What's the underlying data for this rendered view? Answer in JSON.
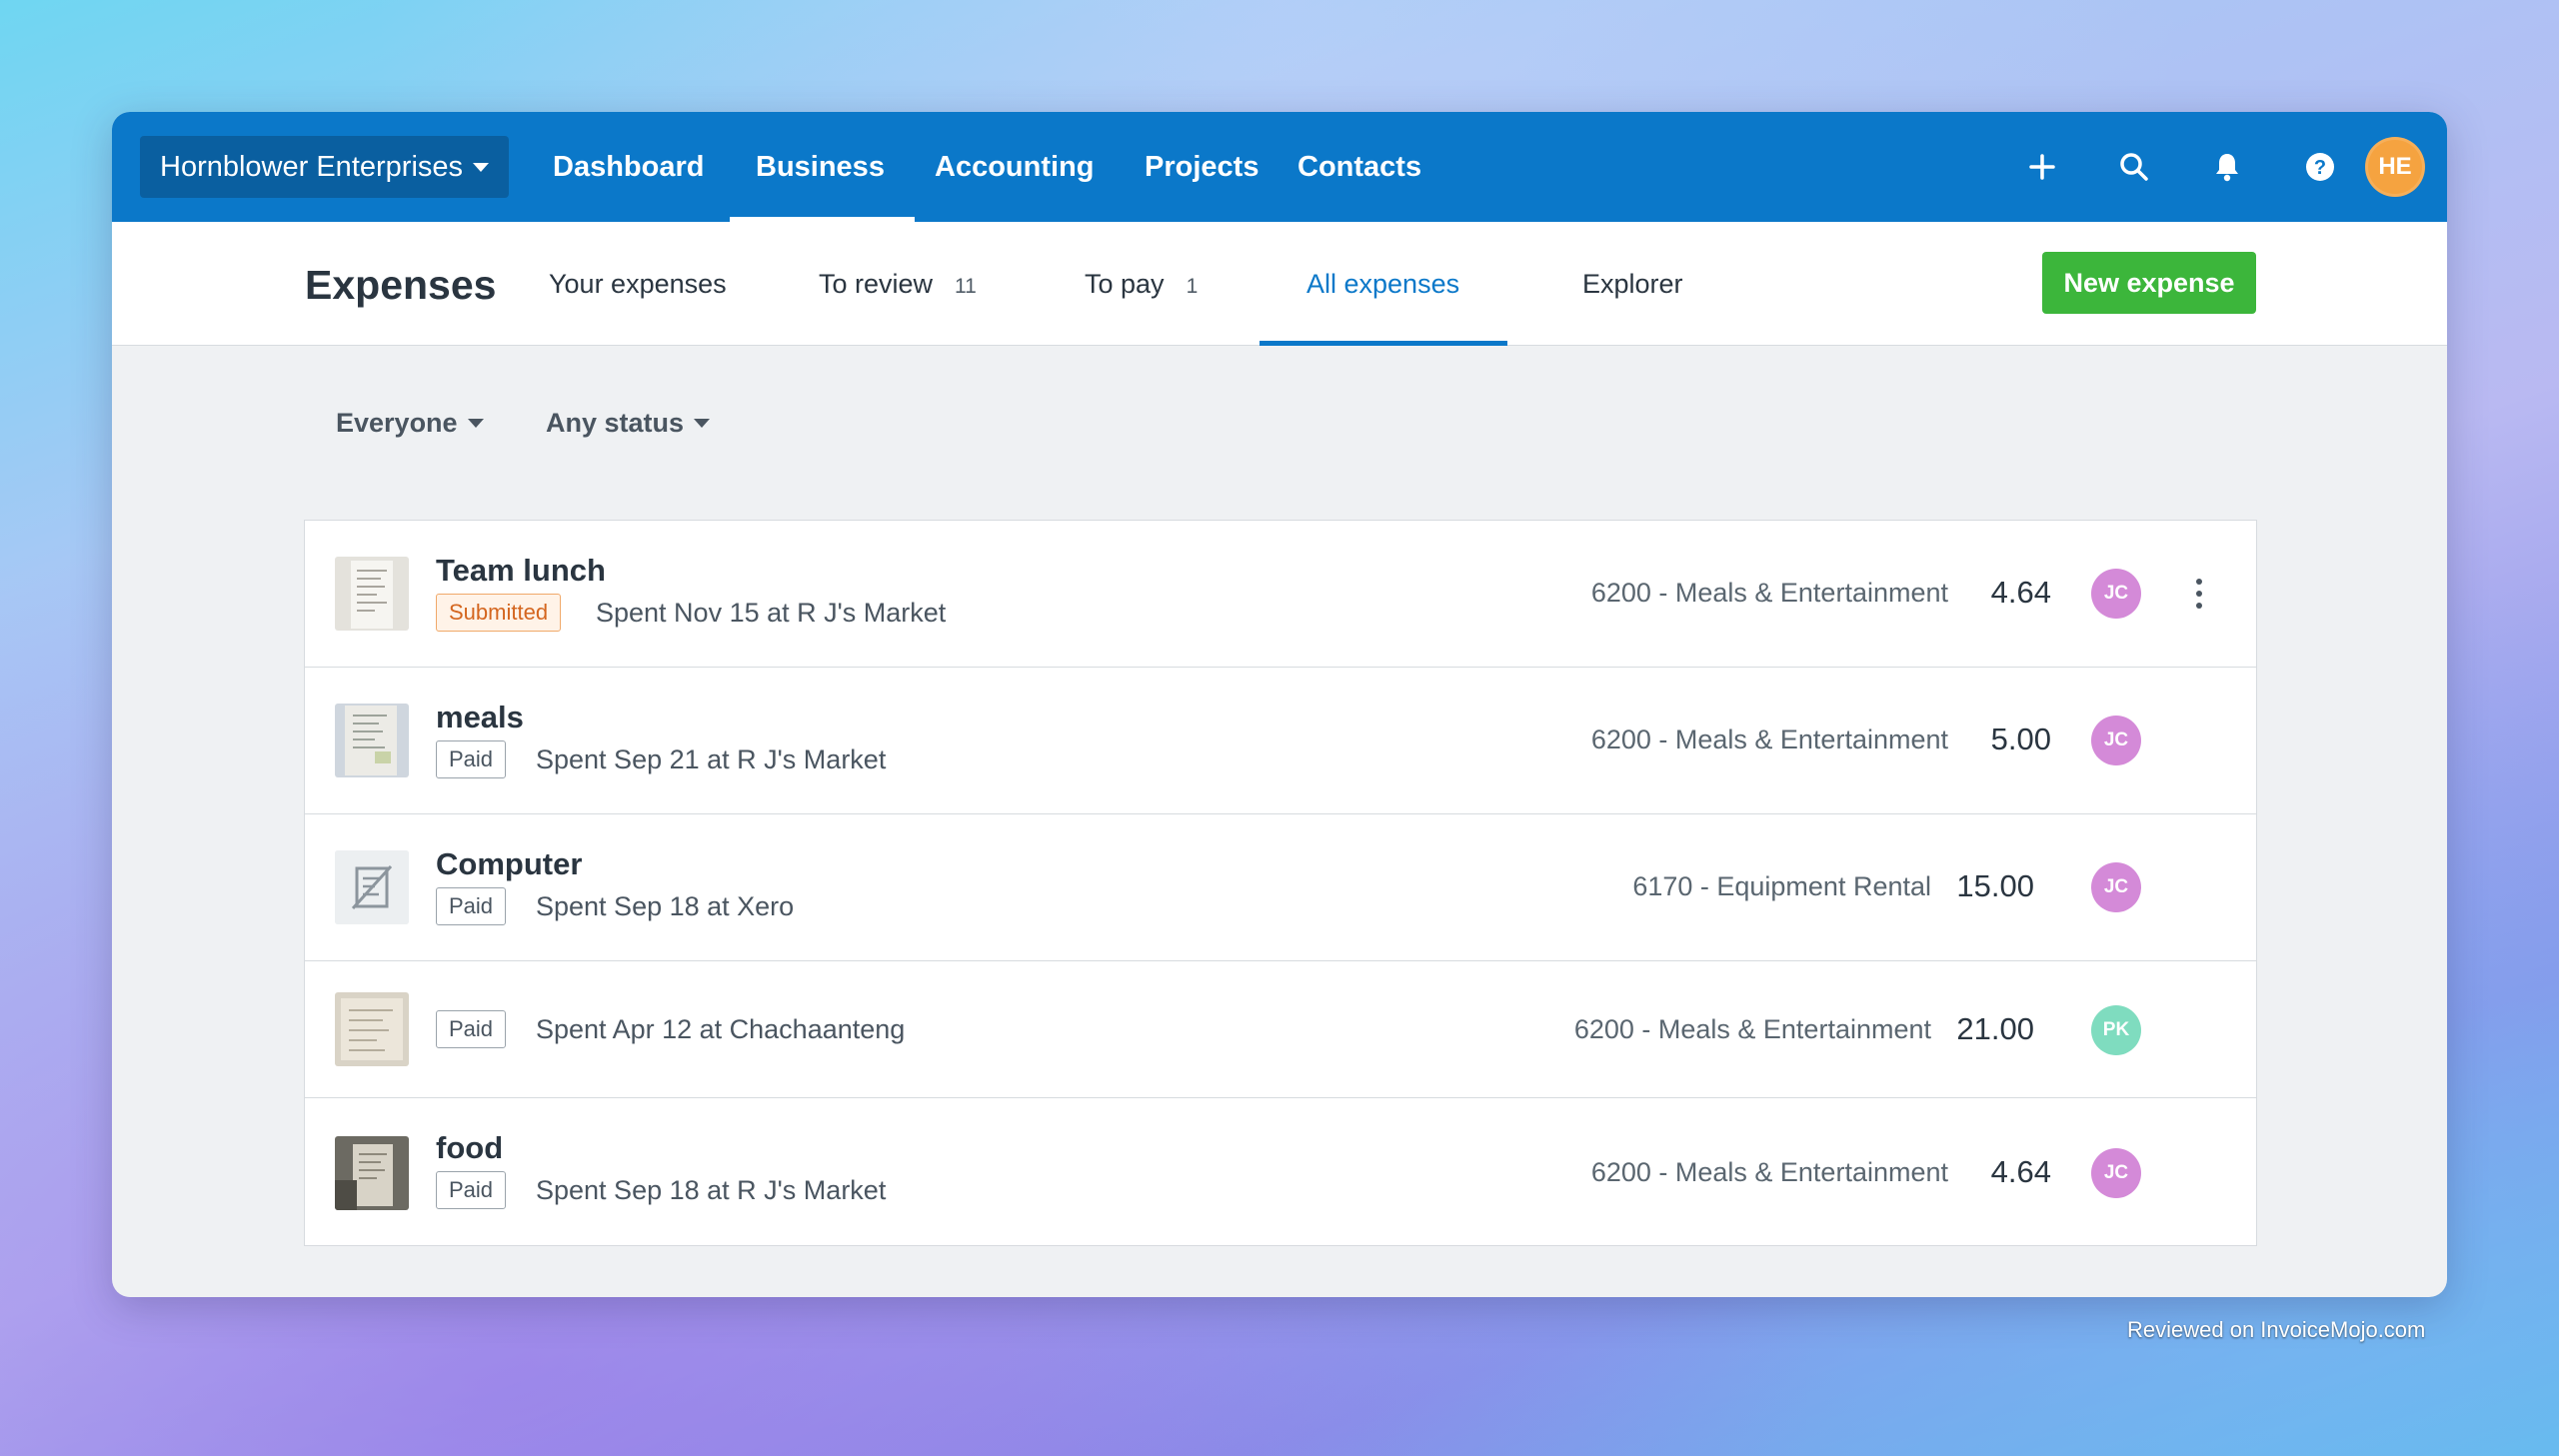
{
  "topnav": {
    "org_name": "Hornblower Enterprises",
    "links": [
      "Dashboard",
      "Business",
      "Accounting",
      "Projects",
      "Contacts"
    ],
    "active_link": "Business",
    "user_initials": "HE",
    "icons": [
      "plus-icon",
      "search-icon",
      "bell-icon",
      "help-icon"
    ]
  },
  "subheader": {
    "title": "Expenses",
    "tabs": [
      {
        "label": "Your expenses",
        "count": ""
      },
      {
        "label": "To review",
        "count": "11"
      },
      {
        "label": "To pay",
        "count": "1"
      },
      {
        "label": "All expenses",
        "count": ""
      },
      {
        "label": "Explorer",
        "count": ""
      }
    ],
    "active_tab": "All expenses",
    "new_expense_label": "New expense"
  },
  "filters": {
    "person": "Everyone",
    "status": "Any status"
  },
  "expenses": [
    {
      "title": "Team lunch",
      "status": "Submitted",
      "meta": "Spent Nov 15 at R J's Market",
      "account": "6200 - Meals & Entertainment",
      "amount": "4.64",
      "user": "JC",
      "receipt": "receipt-image"
    },
    {
      "title": "meals",
      "status": "Paid",
      "meta": "Spent Sep 21 at R J's Market",
      "account": "6200 - Meals & Entertainment",
      "amount": "5.00",
      "user": "JC",
      "receipt": "receipt-image"
    },
    {
      "title": "Computer",
      "status": "Paid",
      "meta": "Spent Sep 18 at Xero",
      "account": "6170 - Equipment Rental",
      "amount": "15.00",
      "user": "JC",
      "receipt": "no-receipt-icon"
    },
    {
      "title": "",
      "status": "Paid",
      "meta": "Spent Apr 12 at Chachaanteng",
      "account": "6200 - Meals & Entertainment",
      "amount": "21.00",
      "user": "PK",
      "receipt": "receipt-image"
    },
    {
      "title": "food",
      "status": "Paid",
      "meta": "Spent Sep 18 at R J's Market",
      "account": "6200 - Meals & Entertainment",
      "amount": "4.64",
      "user": "JC",
      "receipt": "receipt-image"
    }
  ],
  "colors": {
    "nav_blue": "#0b78c9",
    "new_expense_green": "#3cb63b",
    "avatar_he": "#f5a340",
    "avatar_jc": "#d48ad8",
    "avatar_pk": "#7fdcbf",
    "submitted_badge": "#d4661f"
  },
  "watermark": "Reviewed on InvoiceMojo.com"
}
